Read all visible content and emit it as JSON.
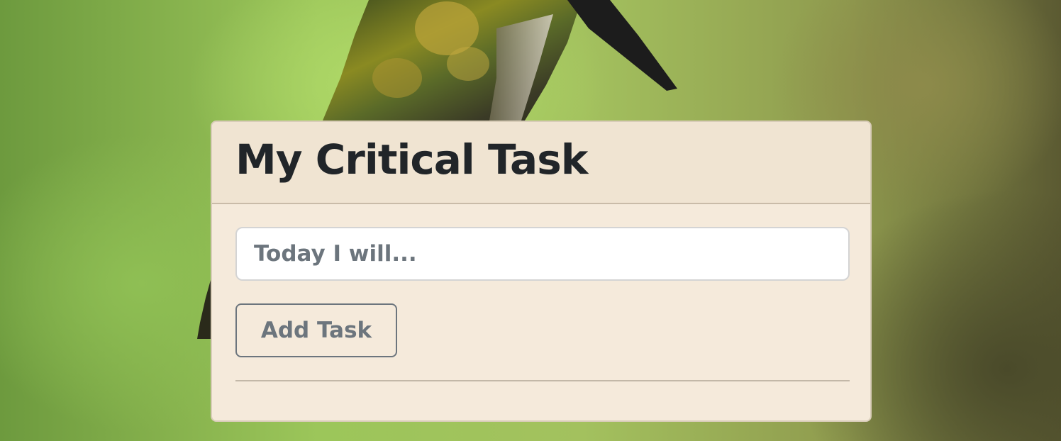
{
  "card": {
    "title": "My Critical Task"
  },
  "form": {
    "input_placeholder": "Today I will...",
    "input_value": "",
    "add_button_label": "Add Task"
  },
  "task_list": [],
  "colors": {
    "card_background": "#f5eadb",
    "card_header_background": "#f0e4d2",
    "title_text": "#212529",
    "button_border": "#6c757d",
    "placeholder_text": "#6c757d"
  },
  "background_image": {
    "subject": "hummingbird-photo"
  }
}
